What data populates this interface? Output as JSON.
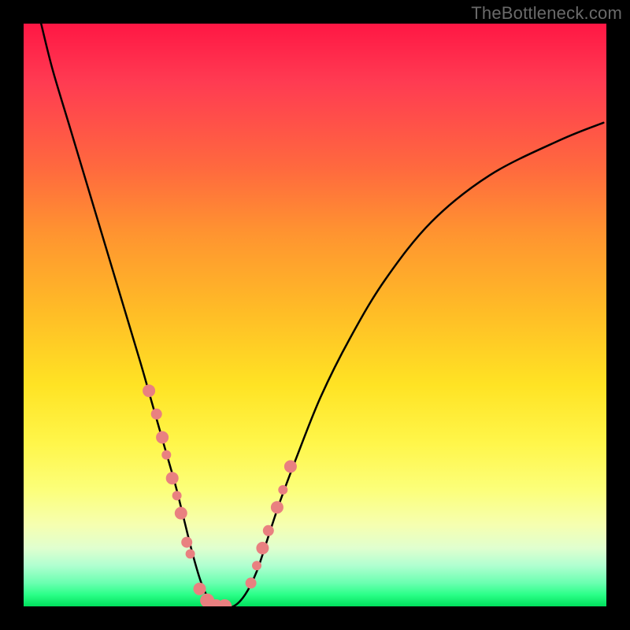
{
  "watermark": "TheBottleneck.com",
  "colors": {
    "frame": "#000000",
    "curve": "#000000",
    "dot": "#e98080",
    "watermark": "#6a6a6a"
  },
  "chart_data": {
    "type": "line",
    "title": "",
    "xlabel": "",
    "ylabel": "",
    "xlim": [
      0,
      100
    ],
    "ylim": [
      0,
      100
    ],
    "grid": false,
    "series": [
      {
        "name": "bottleneck-curve",
        "x": [
          3,
          5,
          8,
          11,
          14,
          17,
          20,
          22,
          24,
          26,
          27.5,
          29,
          30.5,
          32,
          34,
          36,
          38,
          40,
          42,
          44,
          47,
          51,
          56,
          62,
          70,
          80,
          92,
          99.5
        ],
        "values": [
          100,
          92,
          82,
          72,
          62,
          52,
          42,
          35,
          28,
          21,
          15,
          9,
          4,
          1,
          0,
          0,
          2,
          6,
          12,
          18,
          26,
          36,
          46,
          56,
          66,
          74,
          80,
          83
        ]
      }
    ],
    "scatter": [
      {
        "name": "marker-points",
        "x": [
          21.5,
          22.8,
          23.8,
          24.5,
          25.5,
          26.3,
          27.0,
          28.0,
          28.6,
          30.2,
          31.5,
          33.0,
          34.5,
          39.0,
          40.0,
          41.0,
          42.0,
          43.5,
          44.5,
          45.8
        ],
        "values": [
          37,
          33,
          29,
          26,
          22,
          19,
          16,
          11,
          9,
          3,
          1,
          0,
          0,
          4,
          7,
          10,
          13,
          17,
          20,
          24
        ],
        "r": [
          8,
          7,
          8,
          6,
          8,
          6,
          8,
          7,
          6,
          8,
          9,
          9,
          9,
          7,
          6,
          8,
          7,
          8,
          6,
          8
        ]
      }
    ]
  }
}
